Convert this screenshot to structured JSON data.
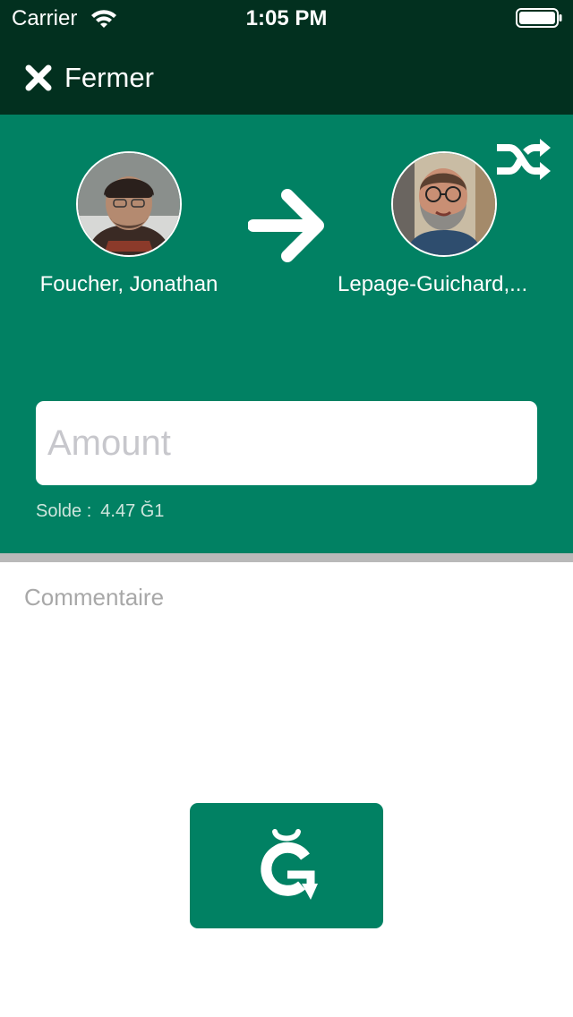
{
  "status_bar": {
    "carrier": "Carrier",
    "time": "1:05 PM",
    "wifi_icon": "wifi-icon",
    "battery_icon": "battery-full-icon"
  },
  "nav": {
    "close_icon": "close-icon",
    "close_label": "Fermer"
  },
  "transfer": {
    "swap_icon": "shuffle-icon",
    "arrow_icon": "arrow-right-icon",
    "from": {
      "name": "Foucher, Jonathan",
      "avatar": "avatar-photo"
    },
    "to": {
      "name": "Lepage-Guichard,...",
      "avatar": "avatar-photo"
    }
  },
  "amount": {
    "value": "",
    "placeholder": "Amount"
  },
  "balance": {
    "label": "Solde :",
    "value": "4.47 Ğ1"
  },
  "comment": {
    "value": "",
    "placeholder": "Commentaire"
  },
  "send_button": {
    "icon": "g1-currency-icon"
  },
  "colors": {
    "header_dark_green": "#02301f",
    "panel_green": "#018163",
    "divider_gray": "#b9b9b9",
    "white": "#ffffff"
  }
}
